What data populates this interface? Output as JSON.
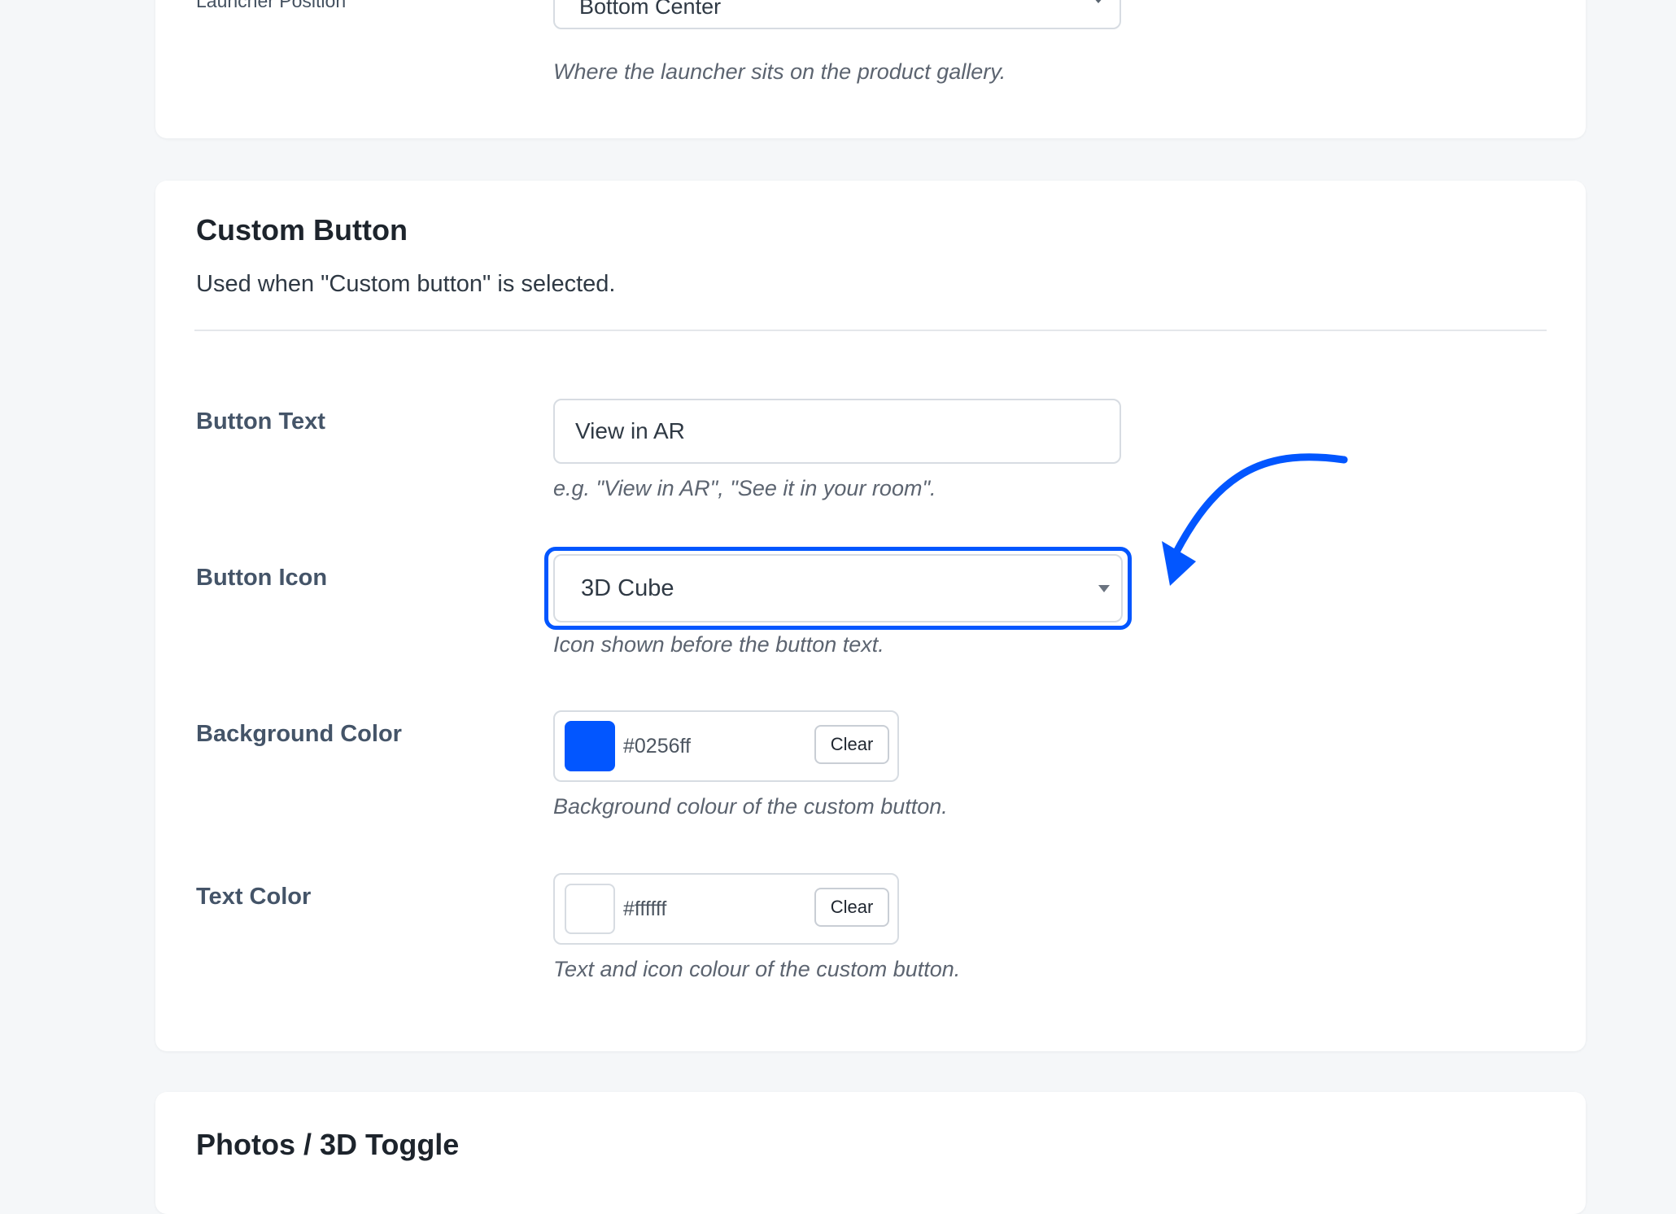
{
  "top_section": {
    "field_label": "Launcher Position",
    "select_value": "Bottom Center",
    "help": "Where the launcher sits on the product gallery."
  },
  "custom_button": {
    "title": "Custom Button",
    "description": "Used when \"Custom button\" is selected.",
    "button_text": {
      "label": "Button Text",
      "value": "View in AR",
      "help": "e.g. \"View in AR\", \"See it in your room\"."
    },
    "button_icon": {
      "label": "Button Icon",
      "value": "3D Cube",
      "help": "Icon shown before the button text."
    },
    "background_color": {
      "label": "Background Color",
      "value": "#0256ff",
      "clear_label": "Clear",
      "help": "Background colour of the custom button."
    },
    "text_color": {
      "label": "Text Color",
      "value": "#ffffff",
      "clear_label": "Clear",
      "help": "Text and icon colour of the custom button."
    }
  },
  "next_section": {
    "title": "Photos / 3D Toggle"
  },
  "colors": {
    "accent": "#0256ff",
    "page_bg": "#f5f7f9",
    "card_bg": "#ffffff"
  },
  "icons": {
    "select_caret": "chevron-down-icon",
    "annotation": "curved-arrow-icon"
  }
}
